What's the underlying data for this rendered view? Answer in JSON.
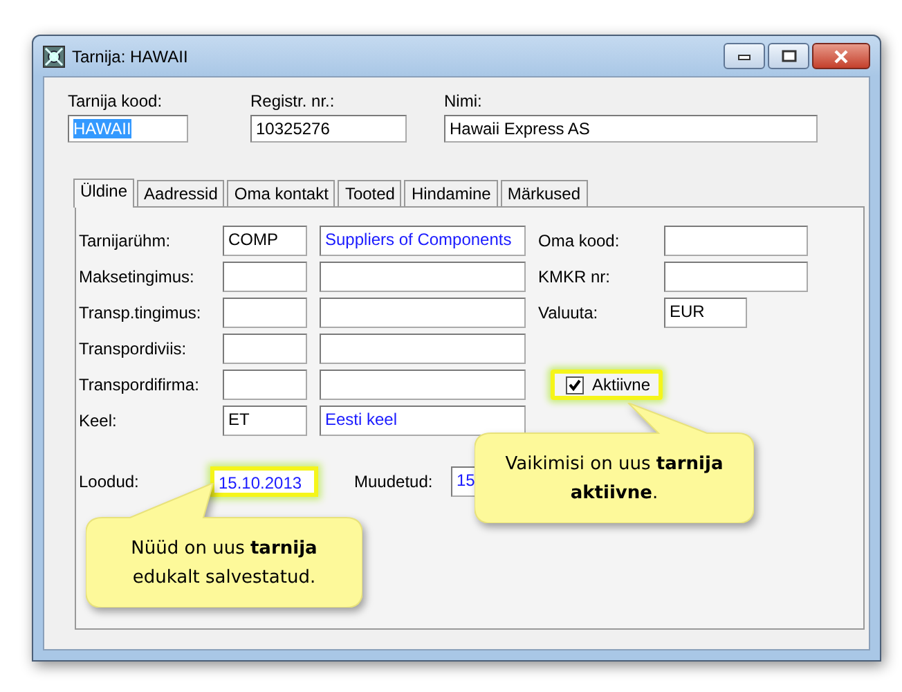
{
  "window": {
    "title": "Tarnija: HAWAII"
  },
  "header_fields": [
    {
      "label": "Tarnija kood:",
      "value": "HAWAII",
      "text_selected": true
    },
    {
      "label": "Registr. nr.:",
      "value": "10325276",
      "text_selected": false
    },
    {
      "label": "Nimi:",
      "value": "Hawaii Express AS",
      "text_selected": false
    }
  ],
  "tabs": [
    {
      "label": "Üldine",
      "selected": true
    },
    {
      "label": "Aadressid",
      "selected": false
    },
    {
      "label": "Oma kontakt",
      "selected": false
    },
    {
      "label": "Tooted",
      "selected": false
    },
    {
      "label": "Hindamine",
      "selected": false
    },
    {
      "label": "Märkused",
      "selected": false
    }
  ],
  "left_fields": [
    {
      "label": "Tarnijarühm:",
      "code": "COMP",
      "description": "Suppliers of Components"
    },
    {
      "label": "Maksetingimus:"
    },
    {
      "label": "Transp.tingimus:"
    },
    {
      "label": "Transpordiviis:"
    },
    {
      "label": "Transpordifirma:"
    },
    {
      "label": "Keel:",
      "code": "ET",
      "description": "Eesti keel"
    }
  ],
  "right_fields": [
    {
      "label": "Oma kood:",
      "kind": "wide"
    },
    {
      "label": "KMKR nr:",
      "kind": "wide"
    },
    {
      "label": "Valuuta:",
      "value": "EUR",
      "kind": "short"
    }
  ],
  "active_checkbox": {
    "label": "Aktiivne",
    "checked": true,
    "highlighted": true
  },
  "dates": [
    {
      "label": "Loodud:",
      "value": "15.10.2013",
      "highlighted": true
    },
    {
      "label": "Muudetud:",
      "value": "15",
      "highlighted": false
    }
  ],
  "callouts": [
    {
      "text": "Vaikimisi on uus **tarnija aktiivne**."
    },
    {
      "text": "Nüüd on uus **tarnija** edukalt salvestatud."
    }
  ]
}
